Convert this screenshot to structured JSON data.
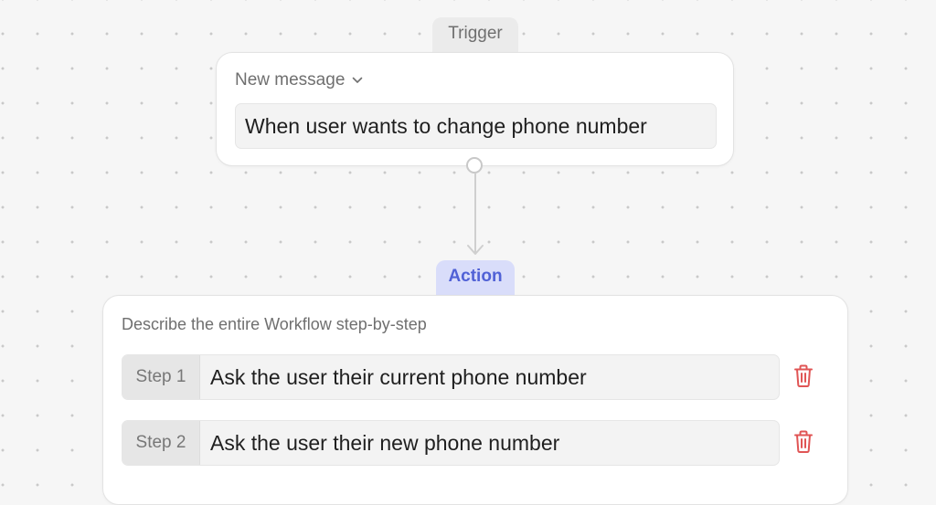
{
  "trigger": {
    "tag_label": "Trigger",
    "dropdown_label": "New message",
    "condition_text": "When user wants to change phone number"
  },
  "action": {
    "tag_label": "Action",
    "describe_label": "Describe the entire Workflow step-by-step",
    "steps": [
      {
        "label": "Step 1",
        "text": "Ask the user their current phone number"
      },
      {
        "label": "Step 2",
        "text": "Ask the user their new phone number"
      }
    ]
  },
  "colors": {
    "action_tag_bg": "#d9ddfa",
    "action_tag_text": "#5061d6",
    "delete_icon": "#e05555"
  },
  "icons": {
    "dropdown": "chevron-down-icon",
    "delete": "trash-icon"
  }
}
